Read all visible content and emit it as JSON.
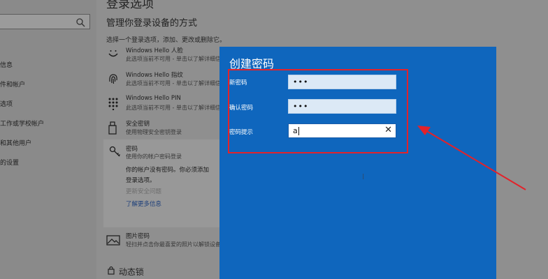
{
  "sidebar": {
    "items": [
      {
        "label": "信息"
      },
      {
        "label": "件和帐户"
      },
      {
        "label": "选项"
      },
      {
        "label": "工作或学校帐户"
      },
      {
        "label": "和其他用户"
      },
      {
        "label": "的设置"
      }
    ]
  },
  "main": {
    "page_title": "登录选项",
    "section_title": "管理你登录设备的方式",
    "select_hint": "选择一个登录选项，添加、更改或删除它。",
    "options": [
      {
        "name": "Windows Hello 人脸",
        "desc": "此选项当前不可用 - 单击以了解详细信息",
        "icon": "face-icon"
      },
      {
        "name": "Windows Hello 指纹",
        "desc": "此选项当前不可用 - 单击以了解详细信息",
        "icon": "fingerprint-icon"
      },
      {
        "name": "Windows Hello PIN",
        "desc": "此选项当前不可用 - 单击以了解详细信息",
        "icon": "pin-keypad-icon"
      },
      {
        "name": "安全密钥",
        "desc": "使用物理安全密钥登录",
        "icon": "usb-key-icon"
      }
    ],
    "password_option": {
      "name": "密码",
      "desc": "使用你的帐户密码登录",
      "text_line1": "你的帐户没有密码。你必须添加",
      "text_line2": "登录选项。",
      "link_disabled": "更新安全问题",
      "link_more": "了解更多信息"
    },
    "picture_password": {
      "name": "图片密码",
      "desc": "轻扫并点击你最喜爱的照片以解锁设备"
    },
    "dynamic_lock": "动态锁"
  },
  "dialog": {
    "title": "创建密码",
    "fields": [
      {
        "label": "新密码",
        "value": "•••"
      },
      {
        "label": "确认密码",
        "value": "•••"
      },
      {
        "label": "密码提示",
        "value": "a"
      }
    ],
    "clear_glyph": "✕"
  },
  "annotation": {
    "color": "#e3222a"
  },
  "colors": {
    "dialog_bg": "#0f66bd",
    "overlay_bg": "#8f8f8f"
  }
}
